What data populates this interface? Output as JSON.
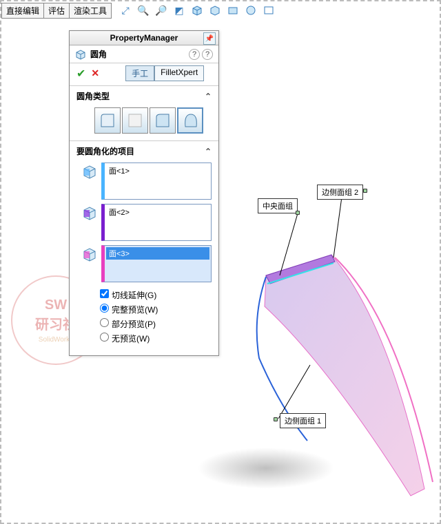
{
  "tabs": [
    "直接编辑",
    "评估",
    "渲染工具"
  ],
  "panel": {
    "title": "PropertyManager",
    "feature_name": "圆角",
    "modes": {
      "manual": "手工",
      "xpert": "FilletXpert"
    },
    "section_type": "圆角类型",
    "section_items": "要圆角化的项目",
    "items": [
      {
        "label": "面<1>"
      },
      {
        "label": "面<2>"
      },
      {
        "label": "面<3>",
        "selected": true
      }
    ],
    "options": {
      "tangent": "切线延伸(G)",
      "full_preview": "完整预览(W)",
      "partial_preview": "部分预览(P)",
      "no_preview": "无预览(W)"
    }
  },
  "callouts": {
    "center": "中央面组",
    "side1": "边侧面组 1",
    "side2": "边侧面组 2"
  },
  "watermark": {
    "l1": "SW",
    "l2": "研习社",
    "l3": "SolidWorks"
  }
}
